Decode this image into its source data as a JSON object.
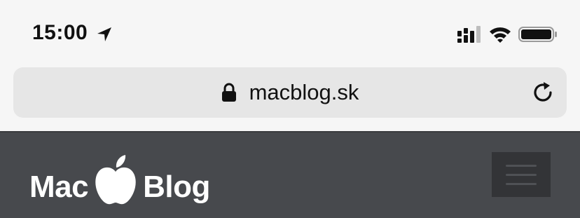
{
  "status_bar": {
    "time": "15:00",
    "icons": [
      "location-arrow-icon",
      "cellular-signal-icon",
      "wifi-icon",
      "battery-icon"
    ]
  },
  "browser": {
    "url": "macblog.sk",
    "icons": [
      "lock-icon",
      "reload-icon"
    ]
  },
  "site_header": {
    "logo_left": "Mac",
    "logo_right": "Blog",
    "logo_icon": "apple-icon",
    "menu_icon": "hamburger-menu-icon",
    "colors": {
      "background": "#47494d",
      "menu_button": "#333437",
      "logo_text": "#ffffff"
    }
  }
}
